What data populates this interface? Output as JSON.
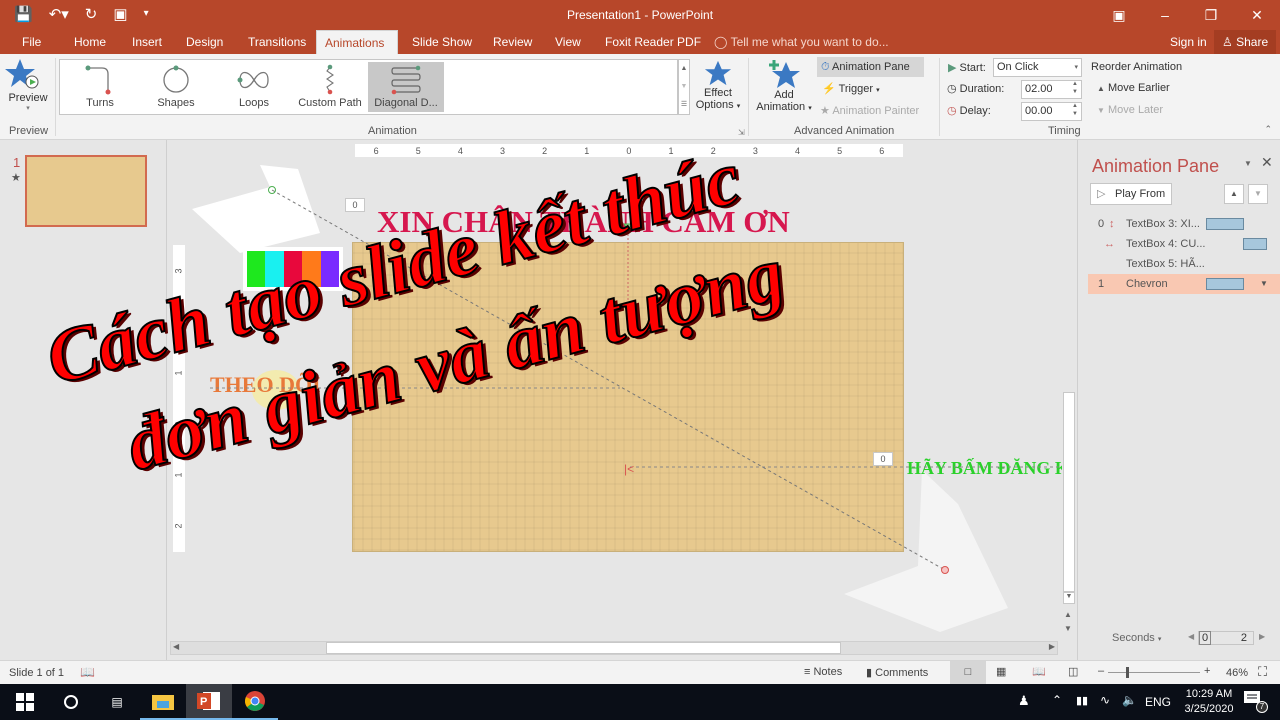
{
  "window": {
    "title": "Presentation1 - PowerPoint"
  },
  "tabs": [
    {
      "label": "File"
    },
    {
      "label": "Home"
    },
    {
      "label": "Insert"
    },
    {
      "label": "Design"
    },
    {
      "label": "Transitions"
    },
    {
      "label": "Animations"
    },
    {
      "label": "Slide Show"
    },
    {
      "label": "Review"
    },
    {
      "label": "View"
    },
    {
      "label": "Foxit Reader PDF"
    }
  ],
  "active_tab": "Animations",
  "tell_me": "Tell me what you want to do...",
  "sign_in": "Sign in",
  "share": "Share",
  "ribbon": {
    "preview": {
      "button": "Preview",
      "group": "Preview"
    },
    "animation_group": "Animation",
    "gallery": [
      {
        "label": "Turns"
      },
      {
        "label": "Shapes"
      },
      {
        "label": "Loops"
      },
      {
        "label": "Custom Path"
      },
      {
        "label": "Diagonal D..."
      }
    ],
    "selected_gallery": "Diagonal D...",
    "effect_options": {
      "line1": "Effect",
      "line2": "Options"
    },
    "advanced": {
      "add_animation_1": "Add",
      "add_animation_2": "Animation",
      "animation_pane": "Animation Pane",
      "trigger": "Trigger",
      "animation_painter": "Animation Painter",
      "group": "Advanced Animation"
    },
    "timing": {
      "start_label": "Start:",
      "start_value": "On Click",
      "duration_label": "Duration:",
      "duration_value": "02.00",
      "delay_label": "Delay:",
      "delay_value": "00.00",
      "reorder": "Reorder Animation",
      "move_earlier": "Move Earlier",
      "move_later": "Move Later",
      "group": "Timing"
    }
  },
  "slides_panel": {
    "number": "1",
    "star": "★"
  },
  "rulers": {
    "horizontal": [
      "6",
      "5",
      "4",
      "3",
      "2",
      "1",
      "0",
      "1",
      "2",
      "3",
      "4",
      "5",
      "6"
    ],
    "vertical": [
      "3",
      "2",
      "1",
      "0",
      "1",
      "2"
    ]
  },
  "slide": {
    "title": "XIN CHÂN THÀNH CẢM ƠN",
    "theo_doi": "THEO DÕI",
    "hay_bam": "HÃY BẤM ĐĂNG KÝ",
    "tags": [
      "0",
      "0"
    ],
    "color_bars": [
      "#1ee81e",
      "#19f0f0",
      "#e8083c",
      "#ff7a1a",
      "#7a2bff"
    ]
  },
  "overlay_text": {
    "line1": "Cách tạo slide kết thúc",
    "line2": "đơn giản và ấn tượng"
  },
  "animation_pane": {
    "title": "Animation Pane",
    "play_from": "Play From",
    "items": [
      {
        "index": "0",
        "label": "TextBox 3: XI..."
      },
      {
        "index": "",
        "label": "TextBox 4: CU..."
      },
      {
        "index": "",
        "label": "TextBox 5: HÃ..."
      },
      {
        "index": "1",
        "label": "Chevron"
      }
    ],
    "seconds": "Seconds",
    "timeline_start": "0",
    "timeline_end": "2"
  },
  "status": {
    "slide_info": "Slide 1 of 1",
    "notes": "Notes",
    "comments": "Comments",
    "zoom": "46%"
  },
  "taskbar": {
    "language": "ENG",
    "time": "10:29 AM",
    "date": "3/25/2020",
    "notifications": "7"
  }
}
